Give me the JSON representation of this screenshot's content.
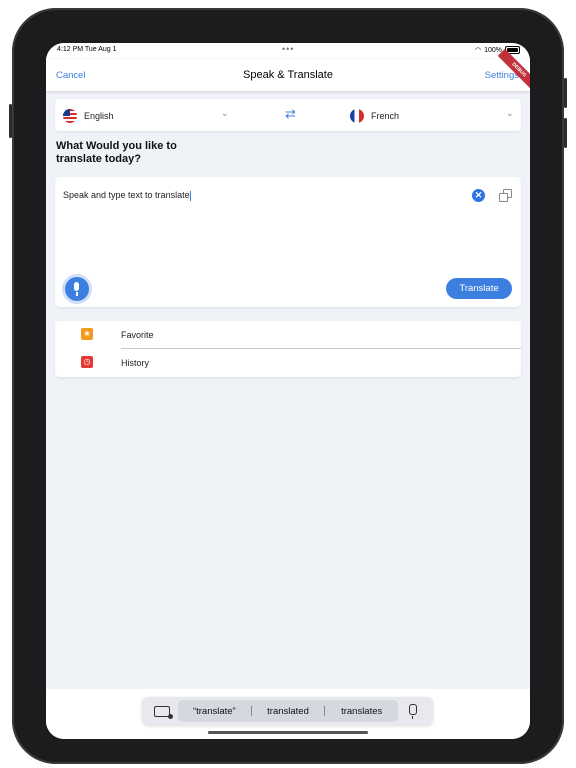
{
  "status_bar": {
    "time": "4:12 PM  Tue Aug 1",
    "dots": "•••",
    "battery": "100%"
  },
  "nav": {
    "cancel": "Cancel",
    "title": "Speak & Translate",
    "settings": "Settings",
    "debug_banner": "DEBUG"
  },
  "languages": {
    "source": "English",
    "target": "French",
    "swap_icon": "swap-arrows-icon"
  },
  "prompt": {
    "question": "What Would you like to\n translate today?"
  },
  "editor": {
    "placeholder": "Speak and type text to translate",
    "clear": "✕",
    "translate_button": "Translate"
  },
  "menu": {
    "items": [
      {
        "label": "Favorite",
        "icon": "star-icon",
        "color": "#f49b1f"
      },
      {
        "label": "History",
        "icon": "clock-icon",
        "color": "#e53935"
      }
    ]
  },
  "keyboard": {
    "suggestions": [
      "“translate”",
      "translated",
      "translates"
    ]
  },
  "colors": {
    "accent": "#3d7fe0",
    "background": "#eff2f7"
  }
}
